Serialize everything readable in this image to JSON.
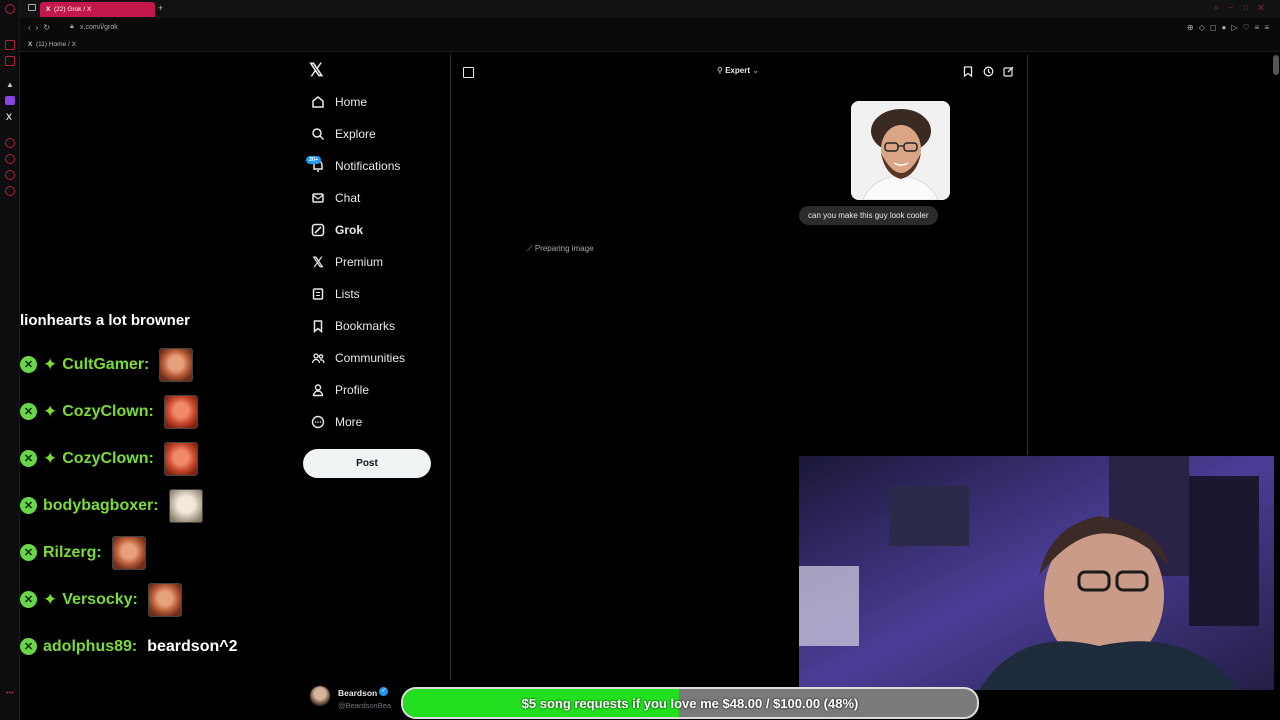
{
  "browser": {
    "active_tab": "(22) Grok / X",
    "url": "x.com/i/grok",
    "bookmark": "(11) Home / X"
  },
  "nav": {
    "items": [
      {
        "label": "Home",
        "icon": "home-icon"
      },
      {
        "label": "Explore",
        "icon": "search-icon"
      },
      {
        "label": "Notifications",
        "icon": "bell-icon"
      },
      {
        "label": "Chat",
        "icon": "mail-icon"
      },
      {
        "label": "Grok",
        "icon": "grok-icon"
      },
      {
        "label": "Premium",
        "icon": "x-icon"
      },
      {
        "label": "Lists",
        "icon": "list-icon"
      },
      {
        "label": "Bookmarks",
        "icon": "bookmark-icon"
      },
      {
        "label": "Communities",
        "icon": "people-icon"
      },
      {
        "label": "Profile",
        "icon": "person-icon"
      },
      {
        "label": "More",
        "icon": "more-icon"
      }
    ],
    "notifications_badge": "20+",
    "post_label": "Post"
  },
  "profile": {
    "name": "Beardson",
    "handle": "@BeardsonBea"
  },
  "grok": {
    "model": "Expert",
    "user_message": "can you make this guy look cooler",
    "status": "Preparing image"
  },
  "stream_chat": {
    "header": "lionhearts a lot browner",
    "messages": [
      {
        "user": "CultGamer:",
        "sparkle": true,
        "emote": "normal",
        "text": ""
      },
      {
        "user": "CozyClown:",
        "sparkle": true,
        "emote": "red",
        "text": ""
      },
      {
        "user": "CozyClown:",
        "sparkle": true,
        "emote": "red",
        "text": ""
      },
      {
        "user": "bodybagboxer:",
        "sparkle": false,
        "emote": "pale",
        "text": ""
      },
      {
        "user": "Rilzerg:",
        "sparkle": false,
        "emote": "normal",
        "text": ""
      },
      {
        "user": "Versocky:",
        "sparkle": true,
        "emote": "normal",
        "text": ""
      },
      {
        "user": "adolphus89:",
        "sparkle": false,
        "emote": "",
        "text": "beardson^2"
      }
    ]
  },
  "goal": {
    "text": "$5 song requests if you love me $48.00 / $100.00 (48%)",
    "progress": 0.48,
    "color": "#22e01f"
  }
}
